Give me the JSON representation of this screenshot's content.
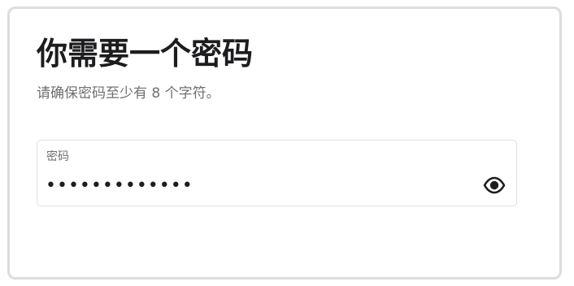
{
  "dialog": {
    "title": "你需要一个密码",
    "subtitle": "请确保密码至少有 8 个字符。"
  },
  "password_field": {
    "label": "密码",
    "value": "•••••••••••••",
    "toggle_icon": "eye-icon"
  },
  "colors": {
    "title": "#1d1d1f",
    "muted_text": "#6f6f74",
    "border": "#e0e0e4",
    "frame_border": "#dcdce2"
  }
}
